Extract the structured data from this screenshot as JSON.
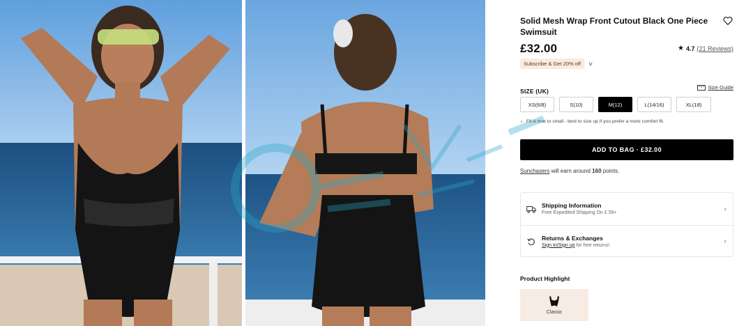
{
  "product": {
    "title": "Solid Mesh Wrap Front Cutout Black One Piece Swimsuit",
    "price": "£32.00",
    "rating": {
      "score": "4.7",
      "reviews": "(21 Reviews)"
    },
    "promo": "Subscribe & Get 20% off"
  },
  "size": {
    "label": "SIZE (UK)",
    "guide": "Size Guide",
    "options": [
      "XS(6/8)",
      "S(10)",
      "M(12)",
      "L(14/16)",
      "XL(18)"
    ],
    "selected": "M(12)",
    "fit_note": "Fit is true to small - best to size up if you prefer a more comfort fit."
  },
  "cart": {
    "add_label": "ADD TO BAG · £32.00"
  },
  "points": {
    "prefix": "Sunchasers",
    "middle": " will earn around ",
    "value": "160",
    "suffix": " points."
  },
  "shipping": {
    "title": "Shipping Information",
    "sub": "Free Expedited Shipping On £ 59+"
  },
  "returns": {
    "title": "Returns & Exchanges",
    "link": "Sign In/Sign up",
    "sub": " for free returns!"
  },
  "highlight": {
    "title": "Product Highlight",
    "item_label": "Classic"
  },
  "icons": [
    "heart-icon",
    "star-icon",
    "chevron-down-icon",
    "ruler-icon",
    "bulb-icon",
    "truck-icon",
    "return-icon",
    "chevron-right-icon",
    "swimsuit-icon"
  ],
  "colors": {
    "accent": "#000000",
    "promo_bg": "#fbeadf",
    "highlight_bg": "#f7ece4"
  }
}
